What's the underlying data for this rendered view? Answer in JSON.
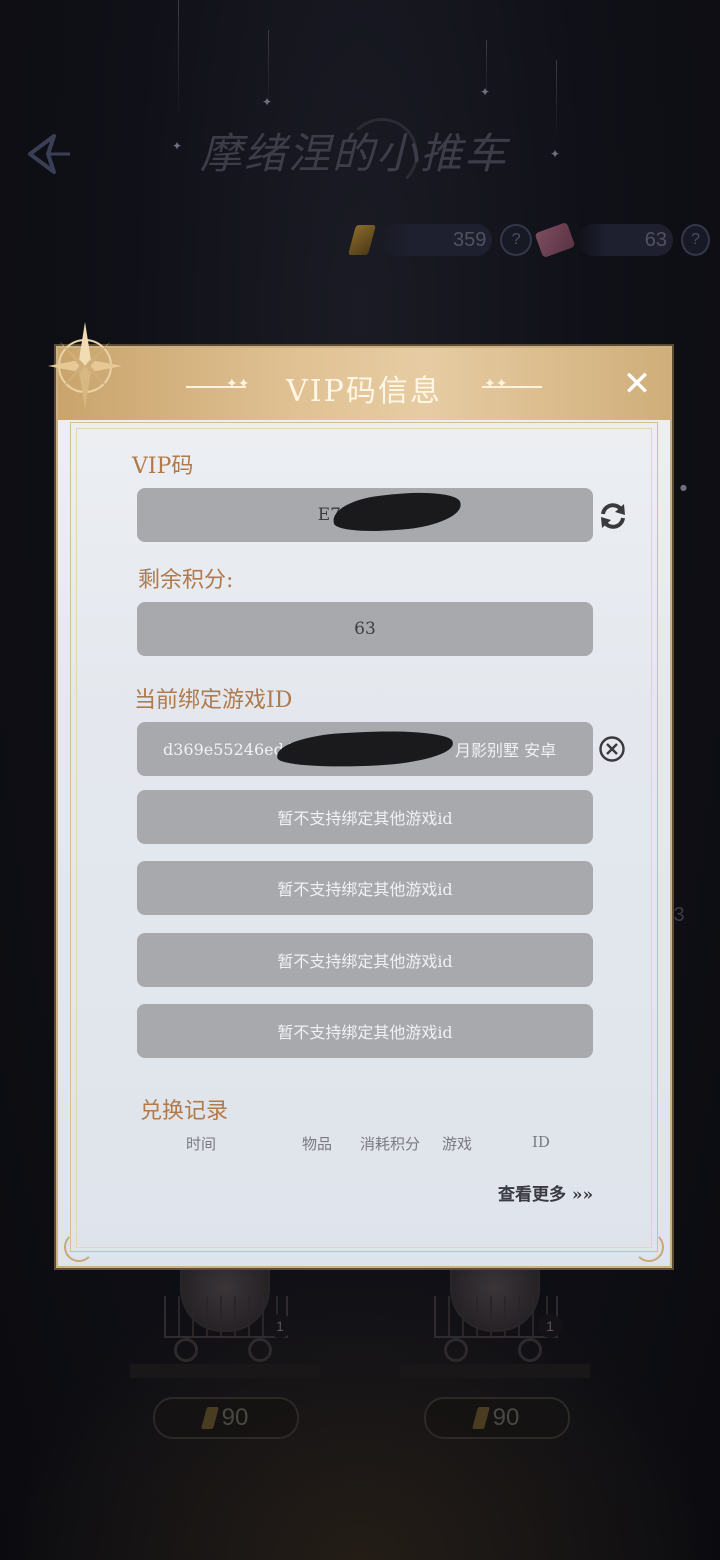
{
  "page": {
    "title": "摩绪涅的小推车",
    "currencies": [
      {
        "icon": "gold-gem-icon",
        "amount": "359"
      },
      {
        "icon": "pink-ticket-icon",
        "amount": "63"
      }
    ],
    "help_glyph": "?",
    "side_fragment": "/3",
    "shop_items": [
      {
        "badge": "1",
        "price": "90"
      },
      {
        "badge": "1",
        "price": "90"
      }
    ]
  },
  "modal": {
    "title": "VIP码信息",
    "close_glyph": "✕",
    "vip_code_label": "VIP码",
    "vip_code_value": "E7L",
    "remaining_points_label": "剩余积分:",
    "remaining_points_value": "63",
    "bound_id_label": "当前绑定游戏ID",
    "bound_id_prefix": "d369e55246ed4",
    "bound_id_suffix": "月影别墅  安卓",
    "unsupported_slots": [
      "暂不支持绑定其他游戏id",
      "暂不支持绑定其他游戏id",
      "暂不支持绑定其他游戏id",
      "暂不支持绑定其他游戏id"
    ],
    "history_label": "兑换记录",
    "history_columns": [
      "时间",
      "物品",
      "消耗积分",
      "游戏",
      "ID"
    ],
    "view_more": "查看更多 »»"
  },
  "colors": {
    "accent_gold": "#cdb285",
    "label_brown": "#b07a4b",
    "field_grey": "#a7a9ad"
  }
}
